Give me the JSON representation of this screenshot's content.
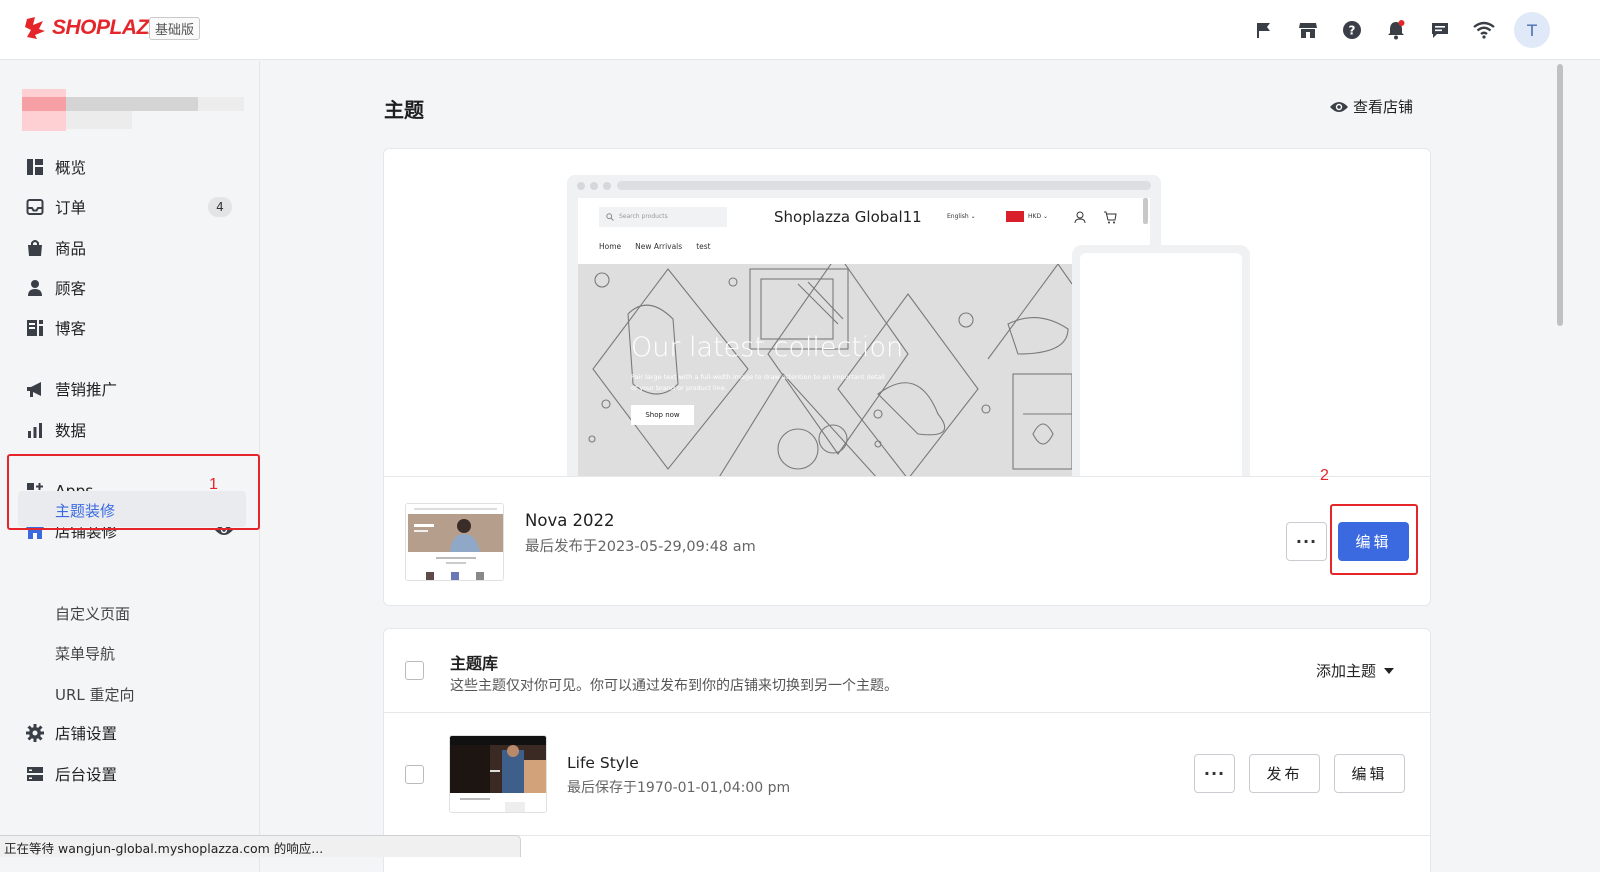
{
  "brand": {
    "name": "SHOPLAZZA",
    "plan_badge": "基础版",
    "accent": "#e4262a",
    "primary": "#3b6ae0"
  },
  "topbar": {
    "icons": [
      "flag-icon",
      "store-icon",
      "help-icon",
      "bell-icon",
      "chat-icon",
      "wifi-icon"
    ],
    "avatar_initial": "T"
  },
  "sidebar": {
    "items": [
      {
        "label": "概览",
        "icon": "dashboard-icon"
      },
      {
        "label": "订单",
        "icon": "inbox-icon",
        "badge": "4"
      },
      {
        "label": "商品",
        "icon": "bag-icon"
      },
      {
        "label": "顾客",
        "icon": "person-icon"
      },
      {
        "label": "博客",
        "icon": "blog-icon"
      },
      {
        "label": "营销推广",
        "icon": "megaphone-icon"
      },
      {
        "label": "数据",
        "icon": "bar-chart-icon"
      },
      {
        "label": "Apps",
        "icon": "apps-icon"
      },
      {
        "label": "店铺装修",
        "icon": "storefront-icon"
      },
      {
        "label": "店铺设置",
        "icon": "gear-icon"
      },
      {
        "label": "后台设置",
        "icon": "server-icon"
      }
    ],
    "subitems": [
      {
        "label": "主题装修",
        "active": true
      },
      {
        "label": "自定义页面"
      },
      {
        "label": "菜单导航"
      },
      {
        "label": "URL 重定向"
      }
    ]
  },
  "annotations": {
    "one": "1",
    "two": "2"
  },
  "main": {
    "title": "主题",
    "view_store": "查看店铺",
    "preview": {
      "search_placeholder": "Search products",
      "store_title": "Shoplazza Global11",
      "language": "English",
      "currency": "HKD",
      "nav": [
        "Home",
        "New Arrivals",
        "test"
      ],
      "hero_heading": "Our latest collection",
      "hero_text": "Pair large text with a full-width image to draw attention to an important detail of your brand or product line.",
      "hero_button": "Shop now"
    },
    "current_theme": {
      "name": "Nova 2022",
      "date": "最后发布于2023-05-29,09:48 am",
      "more_label": "···",
      "edit_label": "编辑"
    },
    "library": {
      "title": "主题库",
      "description": "这些主题仅对你可见。你可以通过发布到你的店铺来切换到另一个主题。",
      "add_theme": "添加主题",
      "themes": [
        {
          "name": "Life Style",
          "date": "最后保存于1970-01-01,04:00 pm",
          "more_label": "···",
          "publish_label": "发布",
          "edit_label": "编辑"
        }
      ]
    }
  },
  "status_bar": "正在等待 wangjun-global.myshoplazza.com 的响应..."
}
